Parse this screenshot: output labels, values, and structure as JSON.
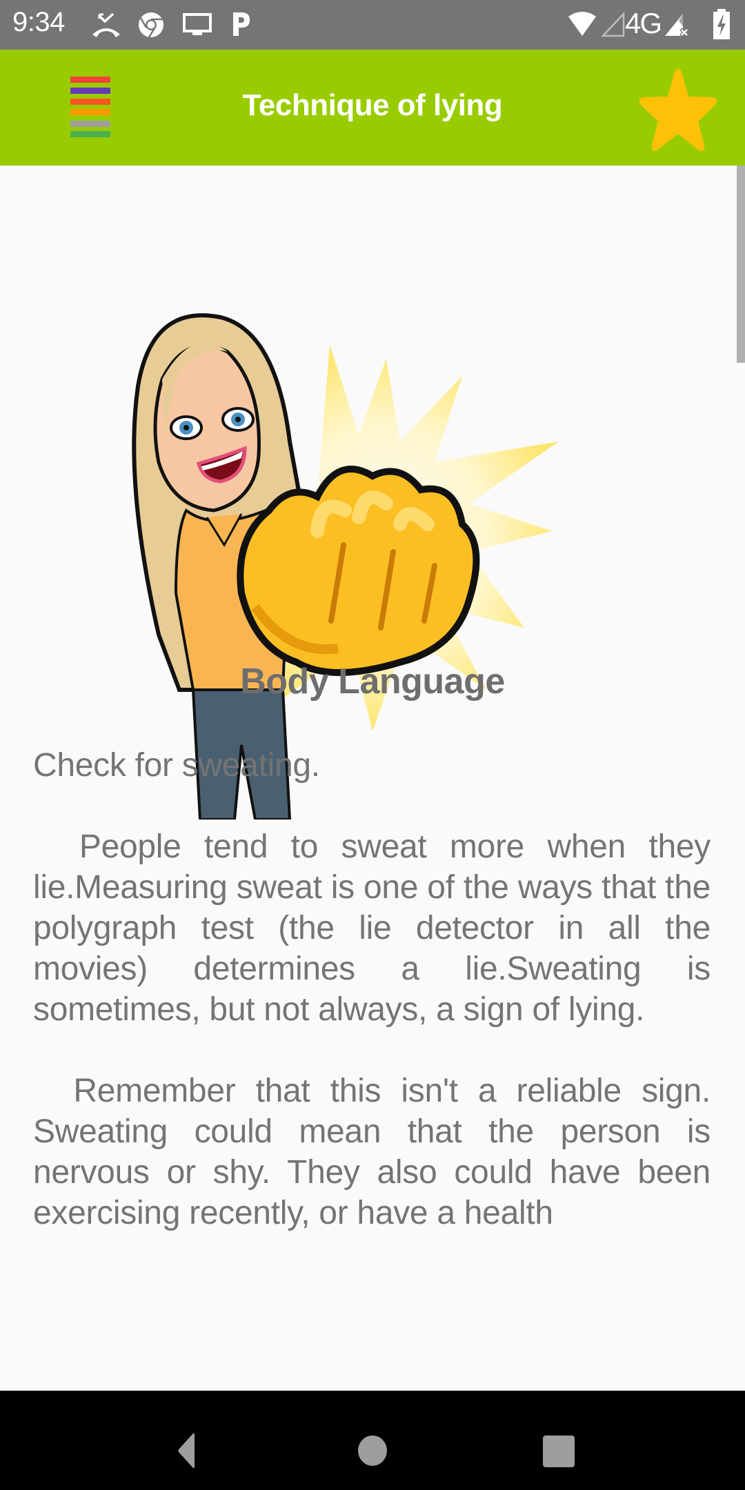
{
  "status_bar": {
    "time": "9:34",
    "left_icons": [
      "missed-call-icon",
      "chrome-icon",
      "cast-screen-icon",
      "pandora-icon"
    ],
    "right_icons": [
      "wifi-icon",
      "signal-empty-icon",
      "network-type",
      "signal-no-sim-icon",
      "battery-charging-icon"
    ],
    "network_type": "4G"
  },
  "app_bar": {
    "title": "Technique of lying",
    "menu_icon": "colorful-menu-icon",
    "menu_colors": [
      "#f44336",
      "#673ab7",
      "#ff5722",
      "#ff9800",
      "#9e9e9e",
      "#4caf50"
    ],
    "favorite_icon": "star-icon",
    "background_color": "#99cc00",
    "star_color": "#ffc107"
  },
  "content": {
    "illustration": "bitmoji-woman-punching-fist",
    "section_title": "Body Language",
    "paragraphs": [
      "Check for sweating.",
      "  People tend to sweat more when they lie.Measuring sweat is one of the ways that the polygraph test (the lie detector in all the movies) determines a lie.Sweating is sometimes, but not always, a sign of lying.",
      "  Remember that this isn't a reliable sign. Sweating could mean that the person is nervous or shy. They also could have been exercising recently, or have a health"
    ],
    "text_color": "#747474"
  },
  "nav_bar": {
    "buttons": [
      "back",
      "home",
      "recents"
    ]
  }
}
